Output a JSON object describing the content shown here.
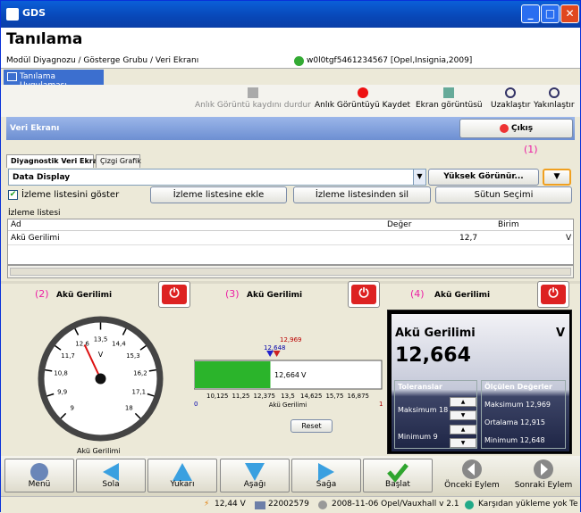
{
  "window": {
    "title": "GDS"
  },
  "header": {
    "title": "Tanılama"
  },
  "crumb": {
    "path": "Modül Diyagnozu / Gösterge Grubu / Veri Ekranı",
    "vehicle": "w0l0tgf5461234567 [Opel,Insignia,2009]"
  },
  "apptab": {
    "label": "Tanılama Uygulaması"
  },
  "toolbar": {
    "pause": "Anlık Görüntü kaydını durdur",
    "save": "Anlık Görüntüyü Kaydet",
    "screenshot": "Ekran görüntüsü",
    "zoom_out": "Uzaklaştır",
    "zoom_in": "Yakınlaştır"
  },
  "panel": {
    "title": "Veri Ekranı",
    "exit": "Çıkış"
  },
  "subtabs": {
    "data": "Diyagnostik Veri Ekranı",
    "graph": "Çizgi Grafik"
  },
  "dropdown": {
    "value": "Data Display",
    "right": "Yüksek Görünür..."
  },
  "marker1": "(1)",
  "watch": {
    "show": "İzleme listesini göster",
    "add": "İzleme listesine ekle",
    "remove": "İzleme listesinden sil",
    "cols": "Sütun Seçimi",
    "list_title": "İzleme listesi"
  },
  "grid": {
    "col_name": "Ad",
    "col_value": "Değer",
    "col_unit": "Birim",
    "row_name": "Akü Gerilimi",
    "row_value": "12,7",
    "row_unit": "V"
  },
  "gauges": {
    "m2": "(2)",
    "m3": "(3)",
    "m4": "(4)",
    "title": "Akü Gerilimi",
    "dial": {
      "unit": "V",
      "caption": "Akü Gerilimi",
      "ticks": [
        "9",
        "9,9",
        "10,8",
        "11,7",
        "12,6",
        "13,5",
        "14,4",
        "15,3",
        "16,2",
        "17,1",
        "18"
      ],
      "value": 12.664,
      "min": 9,
      "max": 18
    },
    "bar": {
      "max_label": "12,969",
      "cur_label": "12,648",
      "value_label": "12,664",
      "unit": "V",
      "ticks": [
        "10,125",
        "11,25",
        "12,375",
        "13,5",
        "14,625",
        "15,75",
        "16,875"
      ],
      "left": "0",
      "right": "1",
      "caption": "Akü Gerilimi",
      "reset": "Reset",
      "value": 12.664,
      "min": 9,
      "max": 18
    },
    "digital": {
      "title": "Akü Gerilimi",
      "unit": "V",
      "value": "12,664",
      "tol_title": "Toleranslar",
      "tol_max": "Maksimum 18",
      "tol_min": "Minimum 9",
      "meas_title": "Ölçülen Değerler",
      "meas_max": "Maksimum 12,969",
      "meas_avg": "Ortalama 12,915",
      "meas_min": "Minimum 12,648"
    }
  },
  "nav": {
    "menu": "Menü",
    "left": "Sola",
    "up": "Yukarı",
    "down": "Aşağı",
    "right": "Sağa",
    "start": "Başlat",
    "prev": "Önceki Eylem",
    "next": "Sonraki Eylem"
  },
  "status": {
    "voltage": "12,44 V",
    "id": "22002579",
    "version": "2008-11-06 Opel/Vauxhall v 2.1",
    "upload": "Karşıdan yükleme yok",
    "trunc": "Te"
  },
  "colors": {
    "accent": "#3c6fcf",
    "green": "#2fa52f",
    "red": "#d22222",
    "pink": "#ec1ea4"
  }
}
